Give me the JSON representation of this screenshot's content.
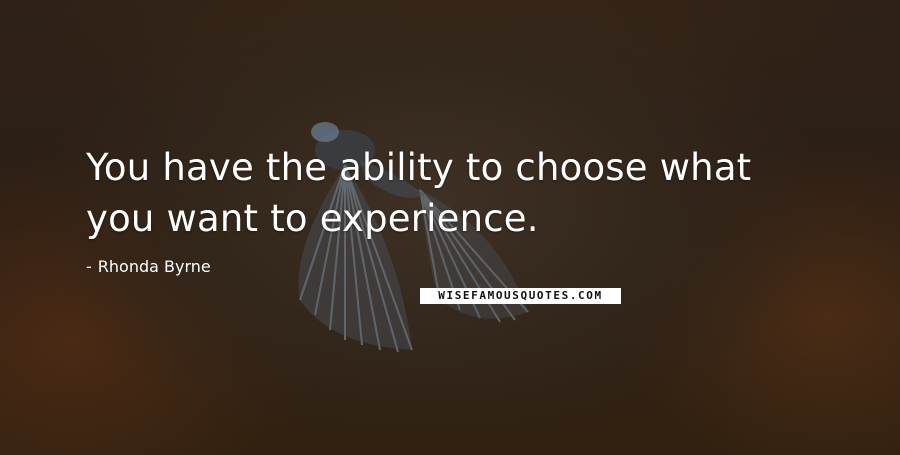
{
  "quote": {
    "line1": "You have the ability to choose what",
    "line2": "you want to experience."
  },
  "author": {
    "dash": "-",
    "name": "Rhonda Byrne"
  },
  "watermark": {
    "text": "WISEFAMOUSQUOTES.COM"
  },
  "colors": {
    "background": "#2a1d14",
    "text": "#ffffff",
    "bird": "#8fa7b8"
  }
}
